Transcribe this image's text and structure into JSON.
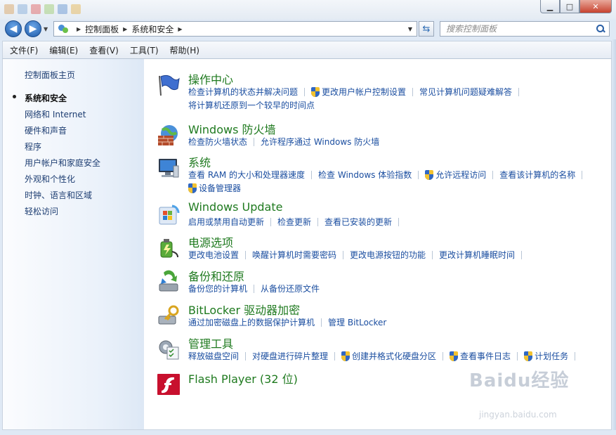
{
  "window": {
    "minimize_glyph": "▁",
    "maximize_glyph": "□",
    "close_glyph": "✕"
  },
  "address": {
    "crumbs": [
      "控制面板",
      "系统和安全"
    ],
    "search_placeholder": "搜索控制面板"
  },
  "menu": [
    "文件(F)",
    "编辑(E)",
    "查看(V)",
    "工具(T)",
    "帮助(H)"
  ],
  "sidebar": {
    "home": "控制面板主页",
    "items": [
      "系统和安全",
      "网络和 Internet",
      "硬件和声音",
      "程序",
      "用户帐户和家庭安全",
      "外观和个性化",
      "时钟、语言和区域",
      "轻松访问"
    ]
  },
  "categories": [
    {
      "title": "操作中心",
      "icon": "action-center-flag-icon",
      "lines": [
        [
          {
            "text": "检查计算机的状态并解决问题"
          },
          {
            "text": "更改用户帐户控制设置",
            "shield": true
          },
          {
            "text": "常见计算机问题疑难解答"
          }
        ],
        [
          {
            "text": "将计算机还原到一个较早的时间点"
          }
        ]
      ]
    },
    {
      "title": "Windows 防火墙",
      "icon": "firewall-icon",
      "lines": [
        [
          {
            "text": "检查防火墙状态"
          },
          {
            "text": "允许程序通过 Windows 防火墙"
          }
        ]
      ]
    },
    {
      "title": "系统",
      "icon": "system-computer-icon",
      "lines": [
        [
          {
            "text": "查看 RAM 的大小和处理器速度"
          },
          {
            "text": "检查 Windows 体验指数"
          },
          {
            "text": "允许远程访问",
            "shield": true
          },
          {
            "text": "查看该计算机的名称"
          }
        ],
        [
          {
            "text": "设备管理器",
            "shield": true
          }
        ]
      ]
    },
    {
      "title": "Windows Update",
      "icon": "windows-update-icon",
      "lines": [
        [
          {
            "text": "启用或禁用自动更新"
          },
          {
            "text": "检查更新"
          },
          {
            "text": "查看已安装的更新"
          }
        ]
      ]
    },
    {
      "title": "电源选项",
      "icon": "power-options-icon",
      "lines": [
        [
          {
            "text": "更改电池设置"
          },
          {
            "text": "唤醒计算机时需要密码"
          },
          {
            "text": "更改电源按钮的功能"
          },
          {
            "text": "更改计算机睡眠时间"
          }
        ]
      ]
    },
    {
      "title": "备份和还原",
      "icon": "backup-restore-icon",
      "lines": [
        [
          {
            "text": "备份您的计算机"
          },
          {
            "text": "从备份还原文件"
          }
        ]
      ]
    },
    {
      "title": "BitLocker 驱动器加密",
      "icon": "bitlocker-icon",
      "lines": [
        [
          {
            "text": "通过加密磁盘上的数据保护计算机"
          },
          {
            "text": "管理 BitLocker"
          }
        ]
      ]
    },
    {
      "title": "管理工具",
      "icon": "admin-tools-icon",
      "lines": [
        [
          {
            "text": "释放磁盘空间"
          },
          {
            "text": "对硬盘进行碎片整理"
          },
          {
            "text": "创建并格式化硬盘分区",
            "shield": true
          },
          {
            "text": "查看事件日志",
            "shield": true
          },
          {
            "text": "计划任务",
            "shield": true
          }
        ]
      ]
    },
    {
      "title": "Flash Player (32 位)",
      "icon": "flash-player-icon",
      "lines": []
    }
  ],
  "watermark": {
    "brand": "Baidu经验",
    "domain": "jingyan.baidu.com"
  }
}
